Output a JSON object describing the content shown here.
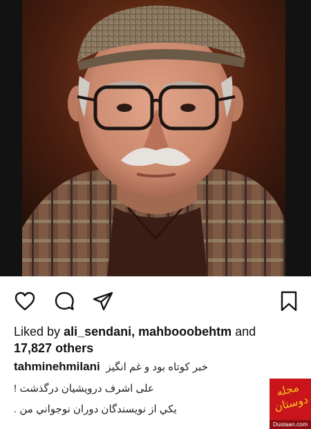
{
  "post": {
    "photo_icon": "portrait-photo",
    "likes": {
      "prefix": "Liked by",
      "user1": "ali_sendani,",
      "user2": "mahbooobehtm",
      "conjunction": "and",
      "count": "17,827",
      "suffix": "others"
    },
    "caption": {
      "username": "tahminehmilani",
      "line1": "خبر کوتاه بود و غم انگیز",
      "line2": "علی اشرف درویشیان درگذشت !",
      "line3": "يکي از نويسندگان دوران نوجواني من ."
    }
  },
  "actions": {
    "like_icon": "heart-icon",
    "comment_icon": "comment-bubble-icon",
    "share_icon": "paper-plane-icon",
    "save_icon": "bookmark-icon"
  },
  "watermark": {
    "logo_text": "مجله دوستان",
    "url": "Dustaan.com",
    "colors": {
      "background": "#c9141b",
      "logo": "#f6c21c"
    }
  }
}
